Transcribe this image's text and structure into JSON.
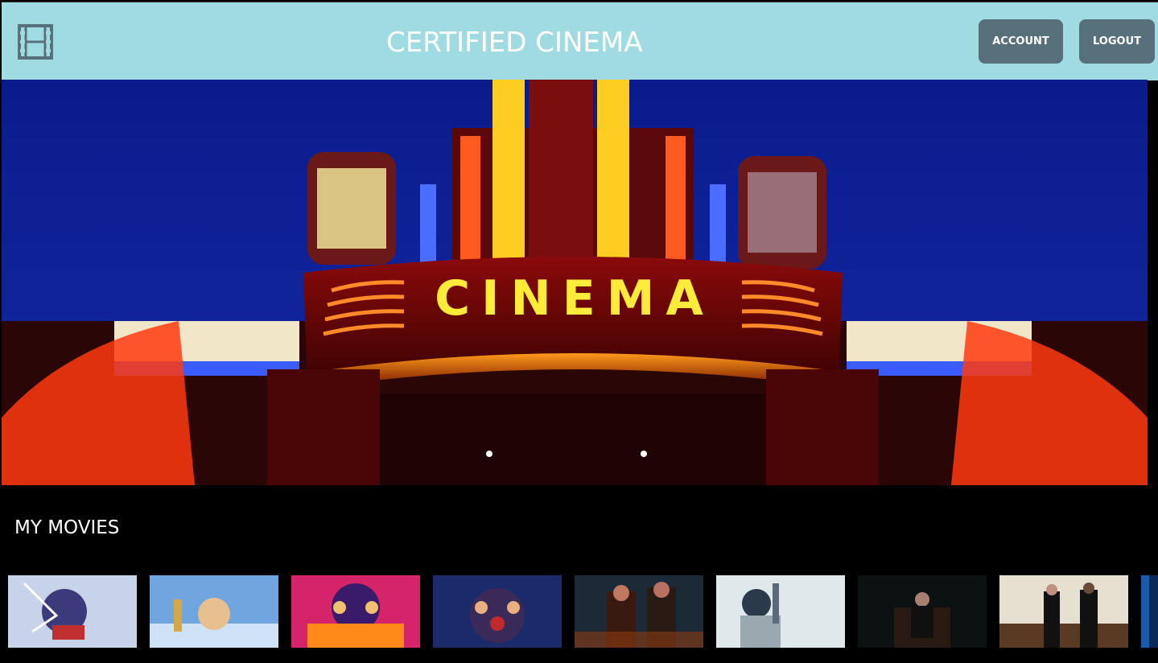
{
  "header": {
    "logo_icon": "film-icon",
    "title": "CERTIFIED CINEMA",
    "account_label": "ACCOUNT",
    "logout_label": "LOGOUT",
    "background_color": "#a1dbe2",
    "button_color": "#58707c"
  },
  "hero": {
    "sign_text": "CINEMA"
  },
  "my_movies": {
    "title": "MY MOVIES",
    "items": [
      {
        "name": "movie-poster-1"
      },
      {
        "name": "movie-poster-2"
      },
      {
        "name": "movie-poster-3"
      },
      {
        "name": "movie-poster-4"
      },
      {
        "name": "movie-poster-5"
      },
      {
        "name": "movie-poster-6"
      },
      {
        "name": "movie-poster-7"
      },
      {
        "name": "movie-poster-8"
      },
      {
        "name": "movie-poster-9"
      }
    ]
  }
}
